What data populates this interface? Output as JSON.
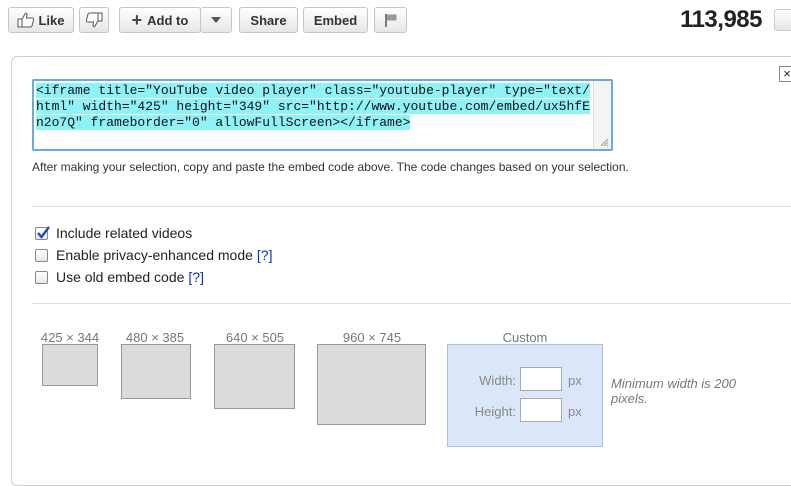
{
  "toolbar": {
    "like_label": "Like",
    "add_to_label": "Add to",
    "share_label": "Share",
    "embed_label": "Embed",
    "view_count": "113,985"
  },
  "embed": {
    "code": "<iframe title=\"YouTube video player\" class=\"youtube-player\" type=\"text/html\" width=\"425\" height=\"349\" src=\"http://www.youtube.com/embed/ux5hfEn2o7Q\" frameborder=\"0\" allowFullScreen></iframe>",
    "instructions": "After making your selection, copy and paste the embed code above. The code changes based on your selection."
  },
  "options": [
    {
      "label": "Include related videos",
      "checked": true,
      "help": ""
    },
    {
      "label": "Enable privacy-enhanced mode",
      "checked": false,
      "help": "[?]"
    },
    {
      "label": "Use old embed code",
      "checked": false,
      "help": "[?]"
    }
  ],
  "sizes": [
    {
      "label": "425 × 344"
    },
    {
      "label": "480 × 385"
    },
    {
      "label": "640 × 505"
    },
    {
      "label": "960 × 745"
    }
  ],
  "custom": {
    "title": "Custom",
    "width_label": "Width:",
    "height_label": "Height:",
    "unit": "px",
    "note": "Minimum width is 200 pixels."
  },
  "colors": {
    "selection": "#8ef3f7",
    "custom_bg": "#dbe6fb",
    "link": "#0033cc"
  }
}
